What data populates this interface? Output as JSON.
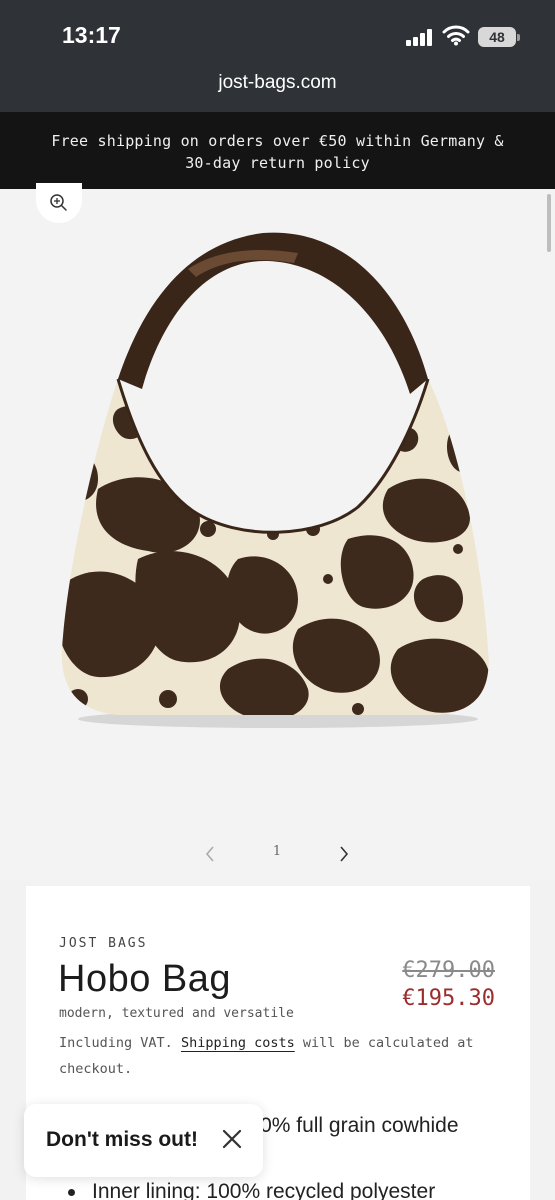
{
  "status_bar": {
    "time": "13:17",
    "battery": "48",
    "icons": [
      "signal-icon",
      "wifi-icon",
      "battery-icon"
    ]
  },
  "browser": {
    "url": "jost-bags.com"
  },
  "announcement": {
    "text": "Free shipping on orders over €50 within Germany & 30-day return policy"
  },
  "product_media": {
    "zoom_icon": "zoom-in-icon",
    "slider": {
      "prev_icon": "chevron-left-icon",
      "current": "1",
      "next_icon": "chevron-right-icon"
    }
  },
  "product": {
    "vendor": "JOST BAGS",
    "title": "Hobo Bag",
    "subtitle": "modern, textured and versatile",
    "price_compare": "€279.00",
    "price_sale": "€195.30",
    "tax_prefix": "Including VAT.",
    "shipping_link": "Shipping costs",
    "tax_suffix": "will be calculated at checkout.",
    "features": [
      "Outer material: 100% full grain cowhide",
      "Inner lining: 100% recycled polyester"
    ]
  },
  "popup": {
    "text": "Don't miss out!",
    "close_icon": "close-icon"
  },
  "colors": {
    "browser_chrome": "#2f3236",
    "announcement_bg": "#141414",
    "sale_price": "#9a2d2d"
  }
}
